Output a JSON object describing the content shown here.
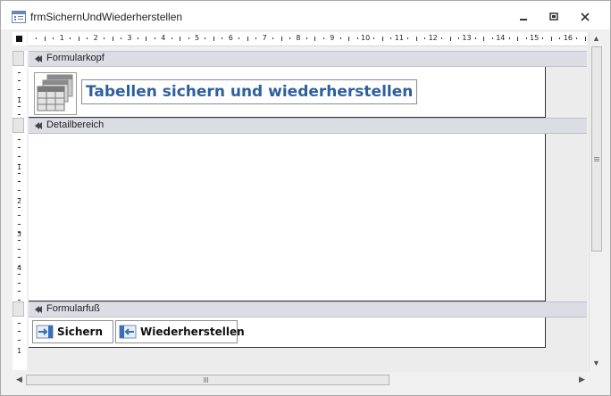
{
  "window": {
    "title": "frmSichernUndWiederherstellen",
    "minimize_icon": "minimize-icon",
    "restore_icon": "restore-icon",
    "close_icon": "close-icon"
  },
  "ruler": {
    "top_numbers": [
      "1",
      "2",
      "3",
      "4",
      "5",
      "6",
      "7",
      "8",
      "9",
      "10",
      "11",
      "12",
      "13",
      "14",
      "15",
      "16"
    ],
    "left_numbers_header": [
      "1"
    ],
    "left_numbers_detail": [
      "1",
      "2",
      "3",
      "4"
    ],
    "left_numbers_footer": [
      "1"
    ]
  },
  "sections": {
    "header_label": "Formularkopf",
    "detail_label": "Detailbereich",
    "footer_label": "Formularfuß"
  },
  "header": {
    "title": "Tabellen sichern und wiederherstellen",
    "icon": "tables-icon"
  },
  "footer": {
    "save_button": "Sichern",
    "restore_button": "Wiederherstellen"
  },
  "colors": {
    "title_text": "#2f5f9e",
    "section_bar": "#dcdce4",
    "button_icon": "#3a6fb8"
  }
}
